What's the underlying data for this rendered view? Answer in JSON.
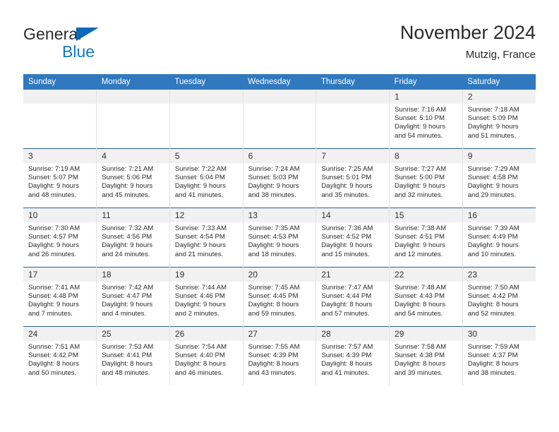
{
  "brand": {
    "name_part1": "General",
    "name_part2": "Blue",
    "triangle_color": "#0b6ab8",
    "blue_color": "#1479c4"
  },
  "header": {
    "title": "November 2024",
    "location": "Mutzig, France"
  },
  "theme": {
    "header_bg": "#3079be",
    "header_text": "#ffffff",
    "daynum_bg": "#f1f1f1",
    "week_divider": "#2d5f94",
    "cell_divider": "#e2e2e2"
  },
  "weekday_headers": [
    "Sunday",
    "Monday",
    "Tuesday",
    "Wednesday",
    "Thursday",
    "Friday",
    "Saturday"
  ],
  "labels": {
    "sunrise_prefix": "Sunrise:",
    "sunset_prefix": "Sunset:",
    "daylight_prefix": "Daylight:"
  },
  "weeks": [
    [
      {
        "day": "",
        "empty": true,
        "sunrise": "",
        "sunset": "",
        "daylight_line1": "",
        "daylight_line2": ""
      },
      {
        "day": "",
        "empty": true,
        "sunrise": "",
        "sunset": "",
        "daylight_line1": "",
        "daylight_line2": ""
      },
      {
        "day": "",
        "empty": true,
        "sunrise": "",
        "sunset": "",
        "daylight_line1": "",
        "daylight_line2": ""
      },
      {
        "day": "",
        "empty": true,
        "sunrise": "",
        "sunset": "",
        "daylight_line1": "",
        "daylight_line2": ""
      },
      {
        "day": "",
        "empty": true,
        "sunrise": "",
        "sunset": "",
        "daylight_line1": "",
        "daylight_line2": ""
      },
      {
        "day": "1",
        "empty": false,
        "sunrise": "Sunrise: 7:16 AM",
        "sunset": "Sunset: 5:10 PM",
        "daylight_line1": "Daylight: 9 hours",
        "daylight_line2": "and 54 minutes."
      },
      {
        "day": "2",
        "empty": false,
        "sunrise": "Sunrise: 7:18 AM",
        "sunset": "Sunset: 5:09 PM",
        "daylight_line1": "Daylight: 9 hours",
        "daylight_line2": "and 51 minutes."
      }
    ],
    [
      {
        "day": "3",
        "empty": false,
        "sunrise": "Sunrise: 7:19 AM",
        "sunset": "Sunset: 5:07 PM",
        "daylight_line1": "Daylight: 9 hours",
        "daylight_line2": "and 48 minutes."
      },
      {
        "day": "4",
        "empty": false,
        "sunrise": "Sunrise: 7:21 AM",
        "sunset": "Sunset: 5:06 PM",
        "daylight_line1": "Daylight: 9 hours",
        "daylight_line2": "and 45 minutes."
      },
      {
        "day": "5",
        "empty": false,
        "sunrise": "Sunrise: 7:22 AM",
        "sunset": "Sunset: 5:04 PM",
        "daylight_line1": "Daylight: 9 hours",
        "daylight_line2": "and 41 minutes."
      },
      {
        "day": "6",
        "empty": false,
        "sunrise": "Sunrise: 7:24 AM",
        "sunset": "Sunset: 5:03 PM",
        "daylight_line1": "Daylight: 9 hours",
        "daylight_line2": "and 38 minutes."
      },
      {
        "day": "7",
        "empty": false,
        "sunrise": "Sunrise: 7:25 AM",
        "sunset": "Sunset: 5:01 PM",
        "daylight_line1": "Daylight: 9 hours",
        "daylight_line2": "and 35 minutes."
      },
      {
        "day": "8",
        "empty": false,
        "sunrise": "Sunrise: 7:27 AM",
        "sunset": "Sunset: 5:00 PM",
        "daylight_line1": "Daylight: 9 hours",
        "daylight_line2": "and 32 minutes."
      },
      {
        "day": "9",
        "empty": false,
        "sunrise": "Sunrise: 7:29 AM",
        "sunset": "Sunset: 4:58 PM",
        "daylight_line1": "Daylight: 9 hours",
        "daylight_line2": "and 29 minutes."
      }
    ],
    [
      {
        "day": "10",
        "empty": false,
        "sunrise": "Sunrise: 7:30 AM",
        "sunset": "Sunset: 4:57 PM",
        "daylight_line1": "Daylight: 9 hours",
        "daylight_line2": "and 26 minutes."
      },
      {
        "day": "11",
        "empty": false,
        "sunrise": "Sunrise: 7:32 AM",
        "sunset": "Sunset: 4:56 PM",
        "daylight_line1": "Daylight: 9 hours",
        "daylight_line2": "and 24 minutes."
      },
      {
        "day": "12",
        "empty": false,
        "sunrise": "Sunrise: 7:33 AM",
        "sunset": "Sunset: 4:54 PM",
        "daylight_line1": "Daylight: 9 hours",
        "daylight_line2": "and 21 minutes."
      },
      {
        "day": "13",
        "empty": false,
        "sunrise": "Sunrise: 7:35 AM",
        "sunset": "Sunset: 4:53 PM",
        "daylight_line1": "Daylight: 9 hours",
        "daylight_line2": "and 18 minutes."
      },
      {
        "day": "14",
        "empty": false,
        "sunrise": "Sunrise: 7:36 AM",
        "sunset": "Sunset: 4:52 PM",
        "daylight_line1": "Daylight: 9 hours",
        "daylight_line2": "and 15 minutes."
      },
      {
        "day": "15",
        "empty": false,
        "sunrise": "Sunrise: 7:38 AM",
        "sunset": "Sunset: 4:51 PM",
        "daylight_line1": "Daylight: 9 hours",
        "daylight_line2": "and 12 minutes."
      },
      {
        "day": "16",
        "empty": false,
        "sunrise": "Sunrise: 7:39 AM",
        "sunset": "Sunset: 4:49 PM",
        "daylight_line1": "Daylight: 9 hours",
        "daylight_line2": "and 10 minutes."
      }
    ],
    [
      {
        "day": "17",
        "empty": false,
        "sunrise": "Sunrise: 7:41 AM",
        "sunset": "Sunset: 4:48 PM",
        "daylight_line1": "Daylight: 9 hours",
        "daylight_line2": "and 7 minutes."
      },
      {
        "day": "18",
        "empty": false,
        "sunrise": "Sunrise: 7:42 AM",
        "sunset": "Sunset: 4:47 PM",
        "daylight_line1": "Daylight: 9 hours",
        "daylight_line2": "and 4 minutes."
      },
      {
        "day": "19",
        "empty": false,
        "sunrise": "Sunrise: 7:44 AM",
        "sunset": "Sunset: 4:46 PM",
        "daylight_line1": "Daylight: 9 hours",
        "daylight_line2": "and 2 minutes."
      },
      {
        "day": "20",
        "empty": false,
        "sunrise": "Sunrise: 7:45 AM",
        "sunset": "Sunset: 4:45 PM",
        "daylight_line1": "Daylight: 8 hours",
        "daylight_line2": "and 59 minutes."
      },
      {
        "day": "21",
        "empty": false,
        "sunrise": "Sunrise: 7:47 AM",
        "sunset": "Sunset: 4:44 PM",
        "daylight_line1": "Daylight: 8 hours",
        "daylight_line2": "and 57 minutes."
      },
      {
        "day": "22",
        "empty": false,
        "sunrise": "Sunrise: 7:48 AM",
        "sunset": "Sunset: 4:43 PM",
        "daylight_line1": "Daylight: 8 hours",
        "daylight_line2": "and 54 minutes."
      },
      {
        "day": "23",
        "empty": false,
        "sunrise": "Sunrise: 7:50 AM",
        "sunset": "Sunset: 4:42 PM",
        "daylight_line1": "Daylight: 8 hours",
        "daylight_line2": "and 52 minutes."
      }
    ],
    [
      {
        "day": "24",
        "empty": false,
        "sunrise": "Sunrise: 7:51 AM",
        "sunset": "Sunset: 4:42 PM",
        "daylight_line1": "Daylight: 8 hours",
        "daylight_line2": "and 50 minutes."
      },
      {
        "day": "25",
        "empty": false,
        "sunrise": "Sunrise: 7:53 AM",
        "sunset": "Sunset: 4:41 PM",
        "daylight_line1": "Daylight: 8 hours",
        "daylight_line2": "and 48 minutes."
      },
      {
        "day": "26",
        "empty": false,
        "sunrise": "Sunrise: 7:54 AM",
        "sunset": "Sunset: 4:40 PM",
        "daylight_line1": "Daylight: 8 hours",
        "daylight_line2": "and 46 minutes."
      },
      {
        "day": "27",
        "empty": false,
        "sunrise": "Sunrise: 7:55 AM",
        "sunset": "Sunset: 4:39 PM",
        "daylight_line1": "Daylight: 8 hours",
        "daylight_line2": "and 43 minutes."
      },
      {
        "day": "28",
        "empty": false,
        "sunrise": "Sunrise: 7:57 AM",
        "sunset": "Sunset: 4:39 PM",
        "daylight_line1": "Daylight: 8 hours",
        "daylight_line2": "and 41 minutes."
      },
      {
        "day": "29",
        "empty": false,
        "sunrise": "Sunrise: 7:58 AM",
        "sunset": "Sunset: 4:38 PM",
        "daylight_line1": "Daylight: 8 hours",
        "daylight_line2": "and 39 minutes."
      },
      {
        "day": "30",
        "empty": false,
        "sunrise": "Sunrise: 7:59 AM",
        "sunset": "Sunset: 4:37 PM",
        "daylight_line1": "Daylight: 8 hours",
        "daylight_line2": "and 38 minutes."
      }
    ]
  ]
}
